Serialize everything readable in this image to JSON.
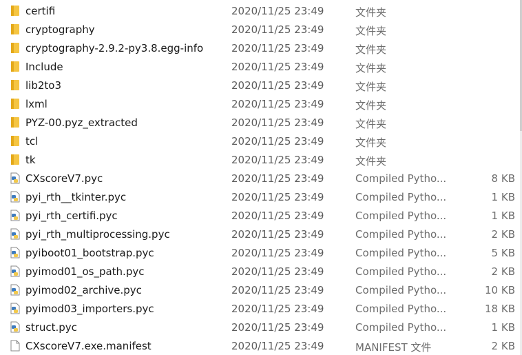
{
  "icons": {
    "folder": "folder-icon",
    "pyc": "python-compiled-file-icon",
    "file": "generic-file-icon"
  },
  "colors": {
    "folder_body": "#f5c542",
    "folder_tab": "#e4a91a",
    "python_blue": "#3f7cbf",
    "python_yellow": "#f2c94c"
  },
  "files": [
    {
      "name": "certifi",
      "date": "2020/11/25 23:49",
      "type": "文件夹",
      "size": "",
      "icon": "folder"
    },
    {
      "name": "cryptography",
      "date": "2020/11/25 23:49",
      "type": "文件夹",
      "size": "",
      "icon": "folder"
    },
    {
      "name": "cryptography-2.9.2-py3.8.egg-info",
      "date": "2020/11/25 23:49",
      "type": "文件夹",
      "size": "",
      "icon": "folder"
    },
    {
      "name": "Include",
      "date": "2020/11/25 23:49",
      "type": "文件夹",
      "size": "",
      "icon": "folder"
    },
    {
      "name": "lib2to3",
      "date": "2020/11/25 23:49",
      "type": "文件夹",
      "size": "",
      "icon": "folder"
    },
    {
      "name": "lxml",
      "date": "2020/11/25 23:49",
      "type": "文件夹",
      "size": "",
      "icon": "folder"
    },
    {
      "name": "PYZ-00.pyz_extracted",
      "date": "2020/11/25 23:49",
      "type": "文件夹",
      "size": "",
      "icon": "folder"
    },
    {
      "name": "tcl",
      "date": "2020/11/25 23:49",
      "type": "文件夹",
      "size": "",
      "icon": "folder"
    },
    {
      "name": "tk",
      "date": "2020/11/25 23:49",
      "type": "文件夹",
      "size": "",
      "icon": "folder"
    },
    {
      "name": "CXscoreV7.pyc",
      "date": "2020/11/25 23:49",
      "type": "Compiled Pytho...",
      "size": "8 KB",
      "icon": "pyc"
    },
    {
      "name": "pyi_rth__tkinter.pyc",
      "date": "2020/11/25 23:49",
      "type": "Compiled Pytho...",
      "size": "1 KB",
      "icon": "pyc"
    },
    {
      "name": "pyi_rth_certifi.pyc",
      "date": "2020/11/25 23:49",
      "type": "Compiled Pytho...",
      "size": "1 KB",
      "icon": "pyc"
    },
    {
      "name": "pyi_rth_multiprocessing.pyc",
      "date": "2020/11/25 23:49",
      "type": "Compiled Pytho...",
      "size": "2 KB",
      "icon": "pyc"
    },
    {
      "name": "pyiboot01_bootstrap.pyc",
      "date": "2020/11/25 23:49",
      "type": "Compiled Pytho...",
      "size": "5 KB",
      "icon": "pyc"
    },
    {
      "name": "pyimod01_os_path.pyc",
      "date": "2020/11/25 23:49",
      "type": "Compiled Pytho...",
      "size": "2 KB",
      "icon": "pyc"
    },
    {
      "name": "pyimod02_archive.pyc",
      "date": "2020/11/25 23:49",
      "type": "Compiled Pytho...",
      "size": "10 KB",
      "icon": "pyc"
    },
    {
      "name": "pyimod03_importers.pyc",
      "date": "2020/11/25 23:49",
      "type": "Compiled Pytho...",
      "size": "18 KB",
      "icon": "pyc"
    },
    {
      "name": "struct.pyc",
      "date": "2020/11/25 23:49",
      "type": "Compiled Pytho...",
      "size": "1 KB",
      "icon": "pyc"
    },
    {
      "name": "CXscoreV7.exe.manifest",
      "date": "2020/11/25 23:49",
      "type": "MANIFEST 文件",
      "size": "2 KB",
      "icon": "file"
    }
  ]
}
